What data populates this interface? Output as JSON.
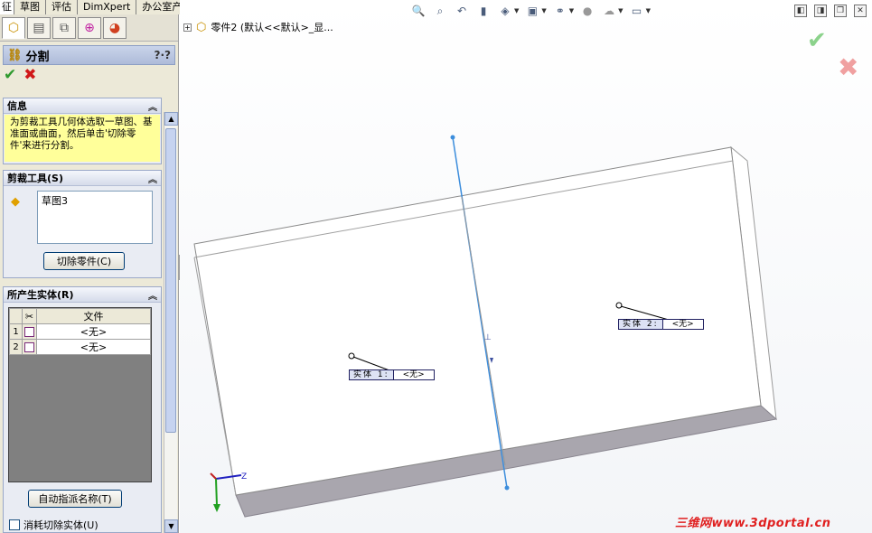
{
  "tabs": [
    "征",
    "草图",
    "评估",
    "DimXpert",
    "办公室产品"
  ],
  "feature": {
    "title": "分割",
    "help": "?·?"
  },
  "info": {
    "header": "信息",
    "text": "为剪裁工具几何体选取一草图、基准面或曲面，然后单击'切除零件'来进行分割。"
  },
  "trim_tools": {
    "header": "剪裁工具(S)",
    "items": [
      "草图3"
    ],
    "cut_button": "切除零件(C)"
  },
  "bodies": {
    "header": "所产生实体(R)",
    "col_file": "文件",
    "rows": [
      {
        "num": "1",
        "file": "<无>"
      },
      {
        "num": "2",
        "file": "<无>"
      }
    ],
    "auto_name_button": "自动指派名称(T)",
    "consume_label": "消耗切除实体(U)"
  },
  "tree": {
    "label": "零件2    (默认<<默认>_显..."
  },
  "callouts": [
    {
      "label": "实体 1:",
      "value": "<无>"
    },
    {
      "label": "实体 2:",
      "value": "<无>"
    }
  ],
  "triad": {
    "z_label": "Z"
  },
  "watermark": {
    "cn": "三维网",
    "url": "www.3dportal.cn"
  },
  "colors": {
    "accent": "#3c8ddc",
    "ok": "#2e9a2e",
    "cancel": "#d01818",
    "info_bg": "#ffff9a"
  },
  "toolbar_icons": [
    "zoom-to-fit-icon",
    "zoom-area-icon",
    "previous-view-icon",
    "section-view-icon",
    "view-orientation-icon",
    "display-style-icon",
    "hide-show-icon",
    "appearance-icon",
    "scene-icon",
    "view-settings-icon"
  ]
}
